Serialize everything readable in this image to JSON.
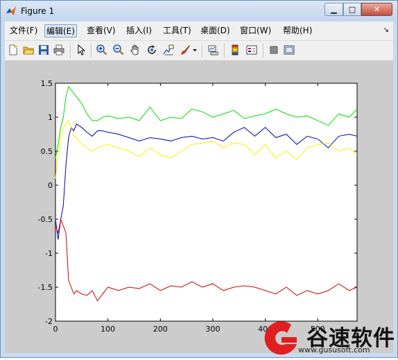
{
  "window": {
    "title": "Figure 1"
  },
  "window_controls": {
    "minimize": "▁",
    "maximize": "□",
    "close": "✕"
  },
  "menu": {
    "items": [
      "文件(F)",
      "编辑(E)",
      "查看(V)",
      "插入(I)",
      "工具(T)",
      "桌面(D)",
      "窗口(W)",
      "帮助(H)"
    ],
    "active_index": 1,
    "overflow": "↘"
  },
  "toolbar": {
    "icons": [
      "new-file-icon",
      "open-folder-icon",
      "save-icon",
      "print-icon",
      "pointer-icon",
      "zoom-in-icon",
      "zoom-out-icon",
      "pan-hand-icon",
      "rotate-3d-icon",
      "data-cursor-icon",
      "brush-icon",
      "dropdown-arrow-icon",
      "link-plot-icon",
      "colorbar-icon",
      "legend-icon",
      "hide-plot-tools-icon",
      "show-plot-tools-icon"
    ]
  },
  "watermark": {
    "text": "谷速软件",
    "url": "www.gususoft.com"
  },
  "colors": {
    "green": "#00dd00",
    "blue": "#0000aa",
    "yellow": "#ffee00",
    "red": "#cc0000"
  },
  "chart_data": {
    "type": "line",
    "title": "",
    "xlabel": "",
    "ylabel": "",
    "xlim": [
      0,
      575
    ],
    "ylim": [
      -2,
      1.5
    ],
    "xticks": [
      0,
      100,
      200,
      300,
      400,
      500
    ],
    "xtick_labels": [
      "0",
      "100",
      "200",
      "300",
      "400",
      "500"
    ],
    "yticks": [
      -2,
      -1.5,
      -1,
      -0.5,
      0,
      0.5,
      1,
      1.5
    ],
    "ytick_labels": [
      "-2",
      "-1.5",
      "-1",
      "-0.5",
      "0",
      "0.5",
      "1",
      "1.5"
    ],
    "grid": false,
    "series": [
      {
        "color": "green",
        "x": [
          0,
          5,
          10,
          15,
          20,
          25,
          30,
          35,
          40,
          50,
          60,
          70,
          80,
          90,
          100,
          120,
          140,
          160,
          180,
          200,
          220,
          240,
          260,
          280,
          300,
          320,
          340,
          360,
          380,
          400,
          420,
          440,
          460,
          480,
          500,
          520,
          540,
          560,
          575
        ],
        "y": [
          0.4,
          0.6,
          0.85,
          1.0,
          1.3,
          1.45,
          1.4,
          1.35,
          1.3,
          1.2,
          1.05,
          0.95,
          0.95,
          1.0,
          1.02,
          0.98,
          1.0,
          0.95,
          1.15,
          0.95,
          1.0,
          0.98,
          1.12,
          1.08,
          1.0,
          1.05,
          1.1,
          0.98,
          1.02,
          1.05,
          1.12,
          1.05,
          1.0,
          1.02,
          0.95,
          0.88,
          1.05,
          1.0,
          1.12
        ]
      },
      {
        "color": "blue",
        "x": [
          0,
          5,
          10,
          15,
          20,
          25,
          30,
          35,
          40,
          50,
          60,
          70,
          80,
          90,
          100,
          120,
          140,
          160,
          180,
          200,
          220,
          240,
          260,
          280,
          300,
          320,
          340,
          360,
          380,
          400,
          420,
          440,
          460,
          480,
          500,
          520,
          540,
          560,
          575
        ],
        "y": [
          -0.5,
          -0.8,
          -0.5,
          -0.3,
          0.3,
          0.7,
          0.85,
          0.8,
          0.9,
          0.85,
          0.78,
          0.72,
          0.8,
          0.8,
          0.78,
          0.75,
          0.7,
          0.65,
          0.7,
          0.68,
          0.65,
          0.7,
          0.72,
          0.68,
          0.7,
          0.65,
          0.78,
          0.85,
          0.72,
          0.85,
          0.7,
          0.75,
          0.6,
          0.72,
          0.68,
          0.55,
          0.72,
          0.75,
          0.72
        ]
      },
      {
        "color": "yellow",
        "x": [
          0,
          5,
          10,
          15,
          20,
          25,
          30,
          35,
          40,
          50,
          60,
          70,
          80,
          90,
          100,
          120,
          140,
          160,
          180,
          200,
          220,
          240,
          260,
          280,
          300,
          320,
          340,
          360,
          380,
          400,
          420,
          440,
          460,
          480,
          500,
          520,
          540,
          560,
          575
        ],
        "y": [
          0.1,
          0.45,
          0.7,
          0.85,
          0.9,
          0.95,
          0.85,
          0.72,
          0.7,
          0.6,
          0.55,
          0.5,
          0.55,
          0.58,
          0.6,
          0.55,
          0.5,
          0.42,
          0.55,
          0.45,
          0.4,
          0.5,
          0.6,
          0.62,
          0.65,
          0.55,
          0.62,
          0.6,
          0.45,
          0.6,
          0.4,
          0.5,
          0.38,
          0.55,
          0.6,
          0.62,
          0.5,
          0.55,
          0.45
        ]
      },
      {
        "color": "red",
        "x": [
          0,
          5,
          10,
          15,
          20,
          25,
          30,
          35,
          40,
          50,
          60,
          70,
          80,
          90,
          100,
          120,
          140,
          160,
          180,
          200,
          220,
          240,
          260,
          280,
          300,
          320,
          340,
          360,
          380,
          400,
          420,
          440,
          460,
          480,
          500,
          520,
          540,
          560,
          575
        ],
        "y": [
          -0.6,
          -0.7,
          -0.5,
          -0.6,
          -0.7,
          -1.4,
          -1.5,
          -1.6,
          -1.55,
          -1.6,
          -1.62,
          -1.55,
          -1.7,
          -1.6,
          -1.5,
          -1.55,
          -1.5,
          -1.52,
          -1.45,
          -1.55,
          -1.48,
          -1.5,
          -1.42,
          -1.5,
          -1.45,
          -1.55,
          -1.5,
          -1.48,
          -1.5,
          -1.55,
          -1.6,
          -1.5,
          -1.62,
          -1.55,
          -1.6,
          -1.55,
          -1.45,
          -1.55,
          -1.5
        ]
      }
    ]
  }
}
